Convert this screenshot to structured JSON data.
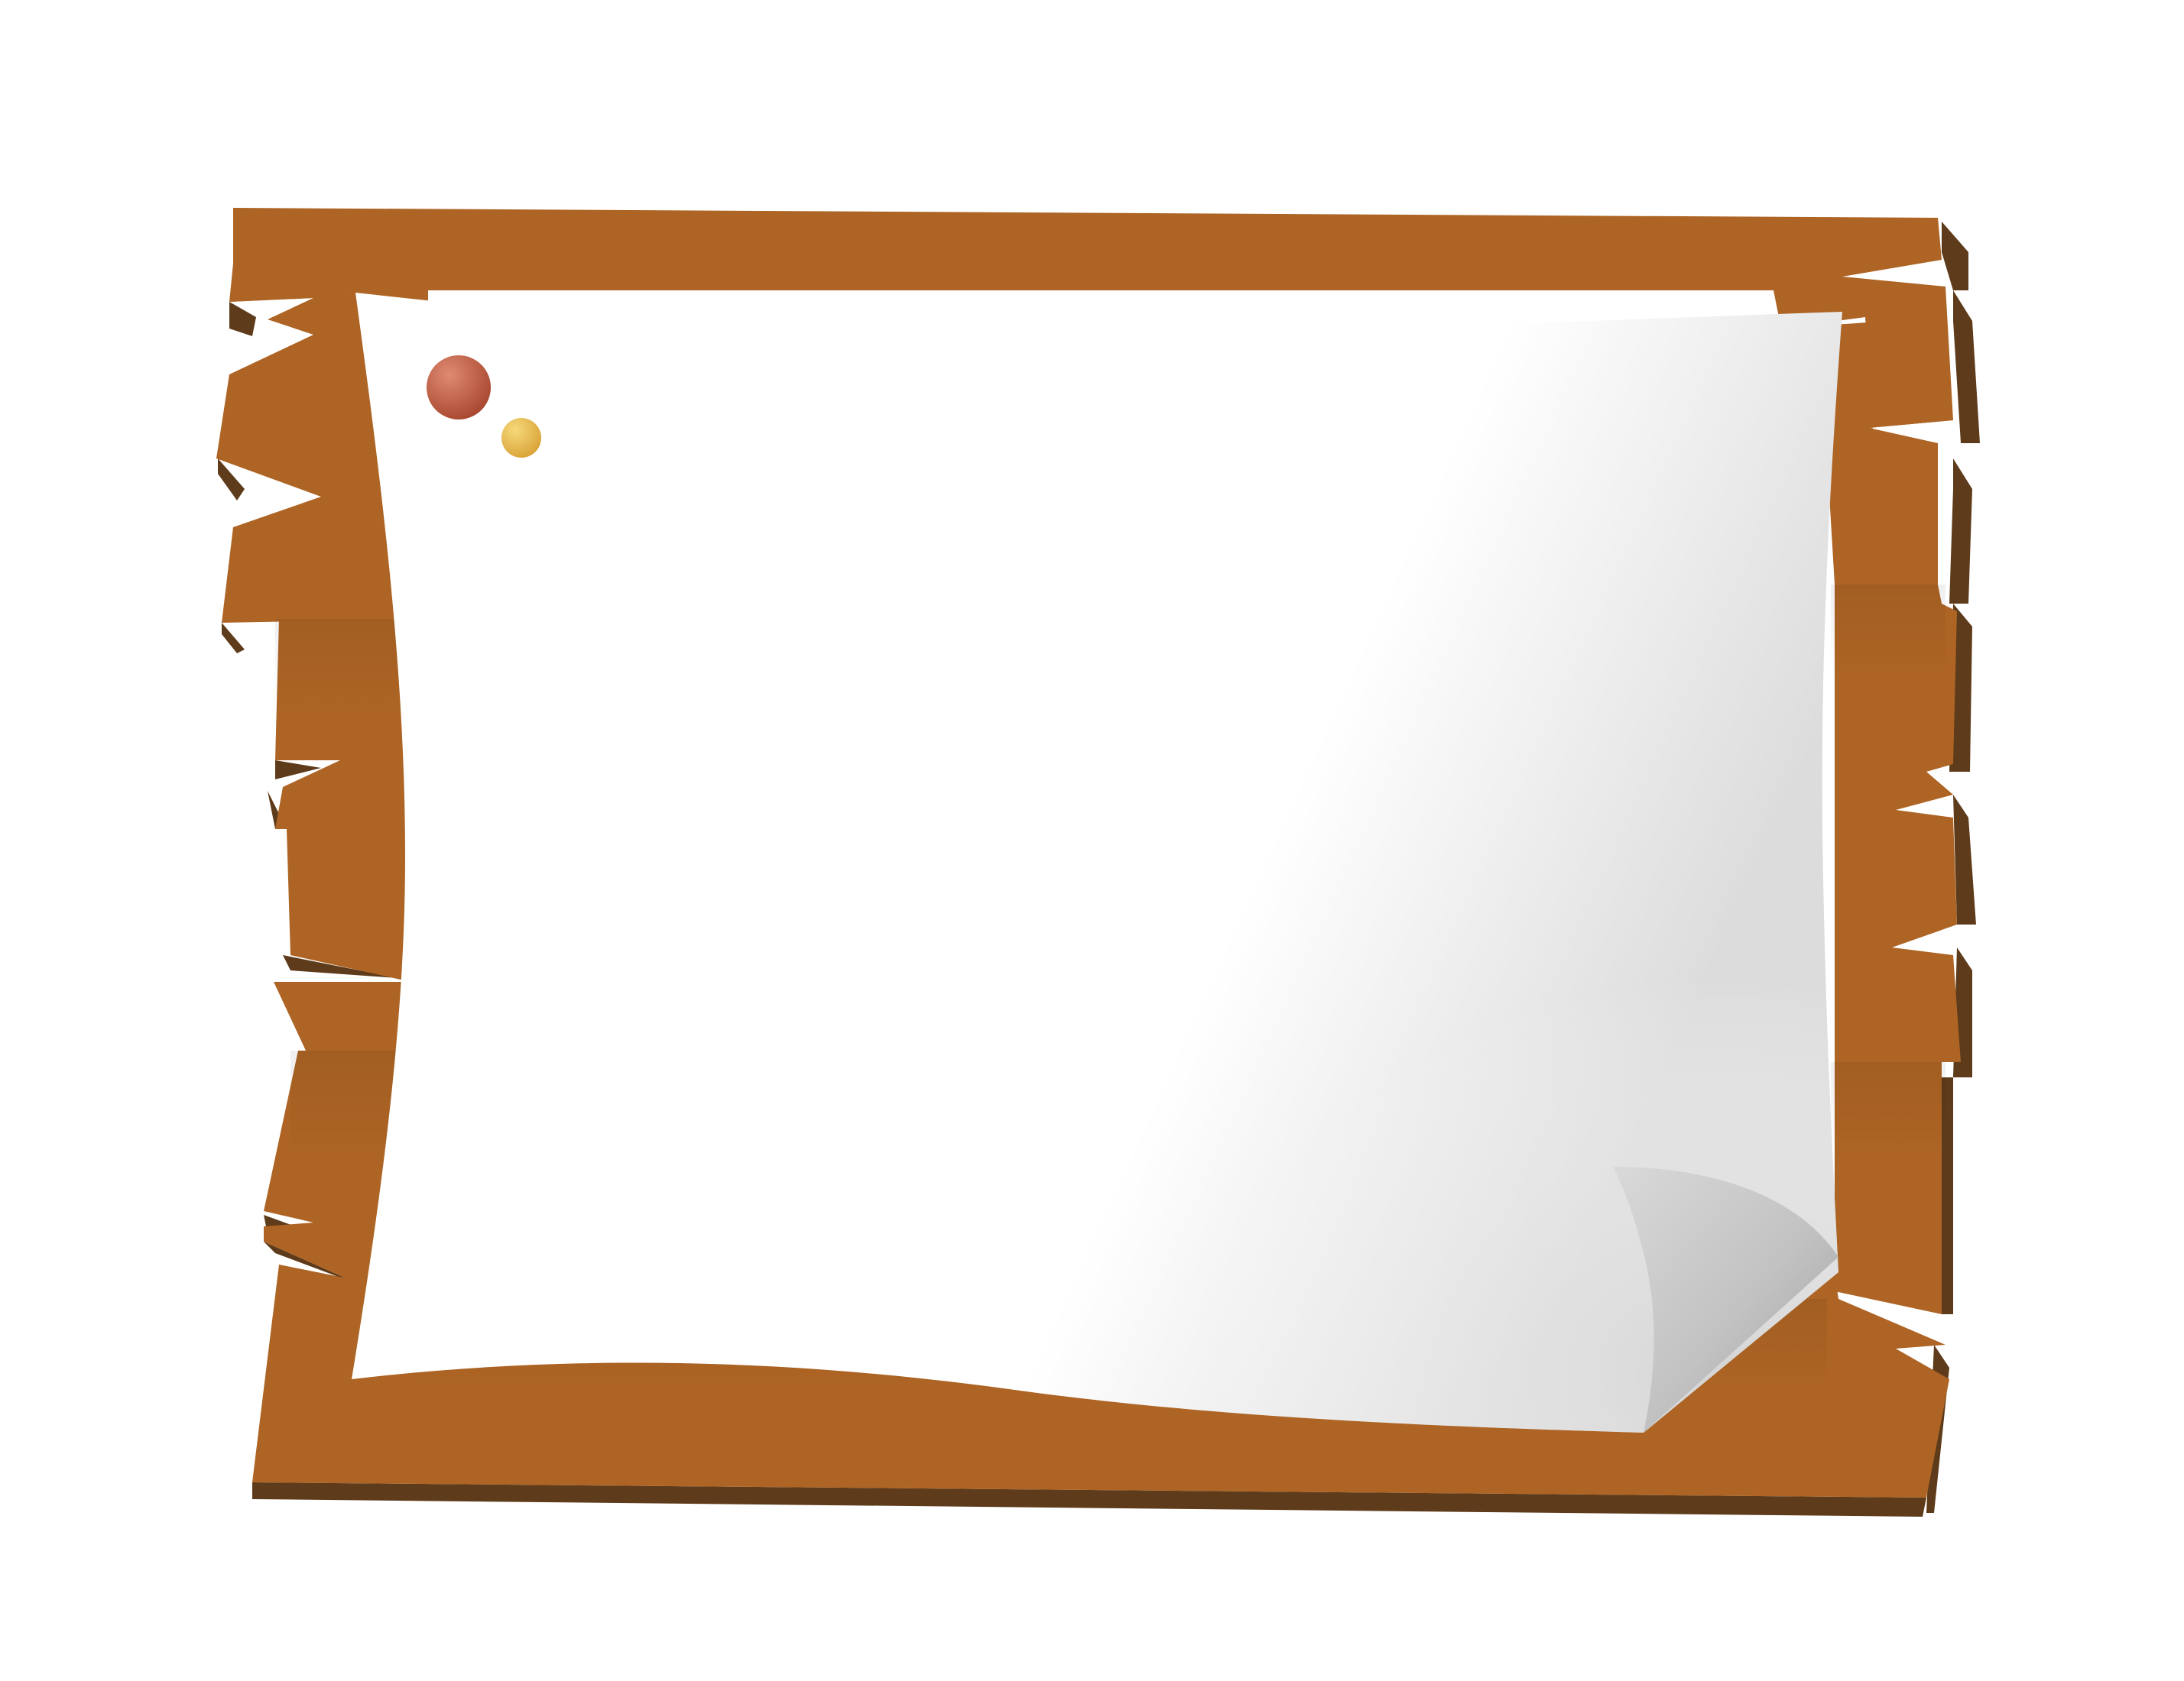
{
  "colors": {
    "background": "#ffffff",
    "wood": "#ad6424",
    "wood_dark": "#8e4f1c",
    "wood_edge": "#5e3b1a",
    "paper": "#ffffff",
    "paper_shadow": "#e2e2e2",
    "curl_light": "#d9d9d9",
    "curl_dark": "#a3a3a3",
    "pin_red": "#b85a42",
    "pin_yellow": "#e8b64a"
  },
  "icons": {
    "red_pin": "pushpin-icon",
    "yellow_pin": "pushpin-icon"
  }
}
